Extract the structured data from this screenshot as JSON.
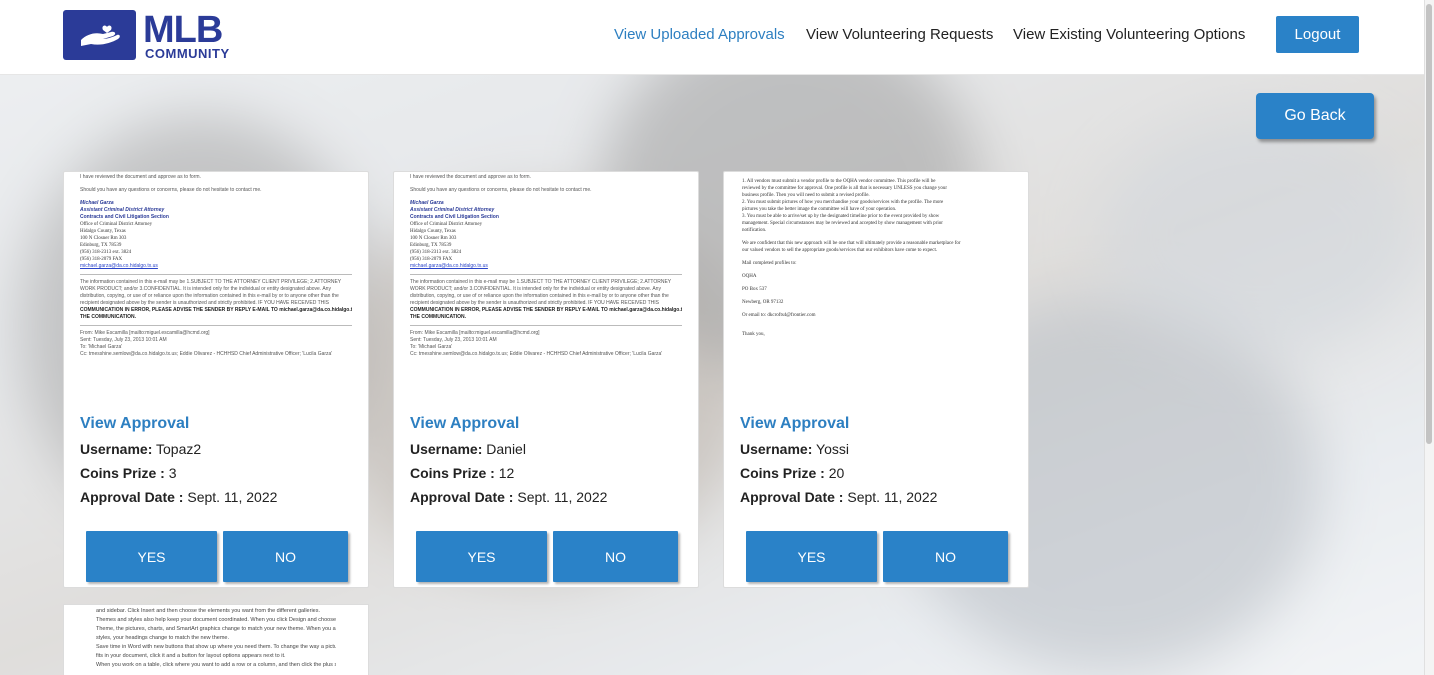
{
  "brand": {
    "logo_main": "MLB",
    "logo_sub": "COMMUNITY"
  },
  "nav": {
    "items": [
      {
        "label": "View Uploaded Approvals",
        "active": true
      },
      {
        "label": "View Volunteering Requests",
        "active": false
      },
      {
        "label": "View Existing Volunteering Options",
        "active": false
      }
    ],
    "logout_label": "Logout"
  },
  "go_back_label": "Go Back",
  "colors": {
    "brand": "#2b3b98",
    "accent": "#2a82c8",
    "link": "#2d7fc1"
  },
  "cards": [
    {
      "view_label": "View Approval",
      "username_label": "Username:",
      "username": "Topaz2",
      "coins_label": "Coins Prize :",
      "coins": "3",
      "date_label": "Approval Date :",
      "date": "Sept. 11, 2022",
      "yes_label": "YES",
      "no_label": "NO",
      "doc": [
        "I have reviewed the document and approve as to form.",
        "Should you have any questions or concerns, please do not hesitate to contact me.",
        "Michael Garza",
        "Assistant Criminal District Attorney",
        "Contracts and Civil Litigation Section",
        "Office of Criminal District Attorney",
        "Hidalgo County, Texas",
        "100 N Closner Rm 303",
        "Edinburg, TX 78539",
        "(956) 318-2313 ext. 3824",
        "(956) 318-2079 FAX",
        "michael.garza@da.co.hidalgo.tx.us",
        "The information contained in this e-mail may be 1.SUBJECT TO THE ATTORNEY CLIENT PRIVILEGE; 2.ATTORNEY",
        "WORK PRODUCT; and/or 3.CONFIDENTIAL. It is intended only for the individual or entity designated above. Any",
        "distribution, copying, or use of or reliance upon the information contained in this e-mail by or to anyone other than the",
        "recipient designated above by the sender is unauthorized and strictly prohibited. IF YOU HAVE RECEIVED THIS",
        "COMMUNICATION IN ERROR, PLEASE ADVISE THE SENDER BY REPLY E-MAIL TO michael.garza@da.co.hidalgo.tx.us AND DELETE",
        "THE COMMUNICATION.",
        "From: Mike Escamilla [mailto:miguel.escamilla@hcmd.org]",
        "Sent: Tuesday, July 23, 2013 10:01 AM",
        "To: 'Michael Garza'",
        "Cc: tmesshine.semlow@da.co.hidalgo.tx.us; Eddie Olivarez - HCHHSD Chief Administrative Officer; 'Lucila Garza'"
      ]
    },
    {
      "view_label": "View Approval",
      "username_label": "Username:",
      "username": "Daniel",
      "coins_label": "Coins Prize :",
      "coins": "12",
      "date_label": "Approval Date :",
      "date": "Sept. 11, 2022",
      "yes_label": "YES",
      "no_label": "NO",
      "doc": [
        "I have reviewed the document and approve as to form.",
        "Should you have any questions or concerns, please do not hesitate to contact me.",
        "Michael Garza",
        "Assistant Criminal District Attorney",
        "Contracts and Civil Litigation Section",
        "Office of Criminal District Attorney",
        "Hidalgo County, Texas",
        "100 N Closner Rm 303",
        "Edinburg, TX 78539",
        "(956) 318-2313 ext. 3824",
        "(956) 318-2079 FAX",
        "michael.garza@da.co.hidalgo.tx.us",
        "The information contained in this e-mail may be 1.SUBJECT TO THE ATTORNEY CLIENT PRIVILEGE; 2.ATTORNEY",
        "WORK PRODUCT; and/or 3.CONFIDENTIAL. It is intended only for the individual or entity designated above. Any",
        "distribution, copying, or use of or reliance upon the information contained in this e-mail by or to anyone other than the",
        "recipient designated above by the sender is unauthorized and strictly prohibited. IF YOU HAVE RECEIVED THIS",
        "COMMUNICATION IN ERROR, PLEASE ADVISE THE SENDER BY REPLY E-MAIL TO michael.garza@da.co.hidalgo.tx.us AND DELETE",
        "THE COMMUNICATION.",
        "From: Mike Escamilla [mailto:miguel.escamilla@hcmd.org]",
        "Sent: Tuesday, July 23, 2013 10:01 AM",
        "To: 'Michael Garza'",
        "Cc: tmesshine.semlow@da.co.hidalgo.tx.us; Eddie Olivarez - HCHHSD Chief Administrative Officer; 'Lucila Garza'"
      ]
    },
    {
      "view_label": "View Approval",
      "username_label": "Username:",
      "username": "Yossi",
      "coins_label": "Coins Prize :",
      "coins": "20",
      "date_label": "Approval Date :",
      "date": "Sept. 11, 2022",
      "yes_label": "YES",
      "no_label": "NO",
      "doc": [
        "1.   All vendors must submit a vendor profile to the OQHA vendor committee. This profile will be",
        "      reviewed by the committee for approval. One profile is all that is necessary UNLESS you change your",
        "      business profile. Then you will need to submit a revised profile.",
        "2.   You must submit pictures of how you merchandise your goods/services with the profile. The more",
        "      pictures you take the better image the committee will have of your operation.",
        "3.   You must be able to arrive/set up by the designated timeline prior to the event provided by show",
        "      management. Special circumstances may be reviewed and accepted by show management with prior",
        "      notification.",
        "We are confident that this new approach will be one that will ultimately provide a reasonable marketplace for",
        "our valued vendors to sell the appropriate goods/services that our exhibitors have come to expect.",
        "Mail completed profiles to:",
        "OQHA",
        "PO Box 537",
        "Newberg, OR 97132",
        "Or email to:      dkcrofts4@frontier.com",
        "Thank you,"
      ]
    }
  ],
  "partial_card_doc": [
    "and sidebar. Click Insert and then choose the elements you want from the different galleries.",
    "Themes and styles also help keep your document coordinated. When you click Design and choose a new",
    "Theme, the pictures, charts, and SmartArt graphics change to match your new theme. When you apply",
    "styles, your headings change to match the new theme.",
    "Save time in Word with new buttons that show up where you need them. To change the way a picture",
    "fits in your document, click it and a button for layout options appears next to it.",
    "When you work on a table, click where you want to add a row or a column, and then click the plus sign."
  ]
}
